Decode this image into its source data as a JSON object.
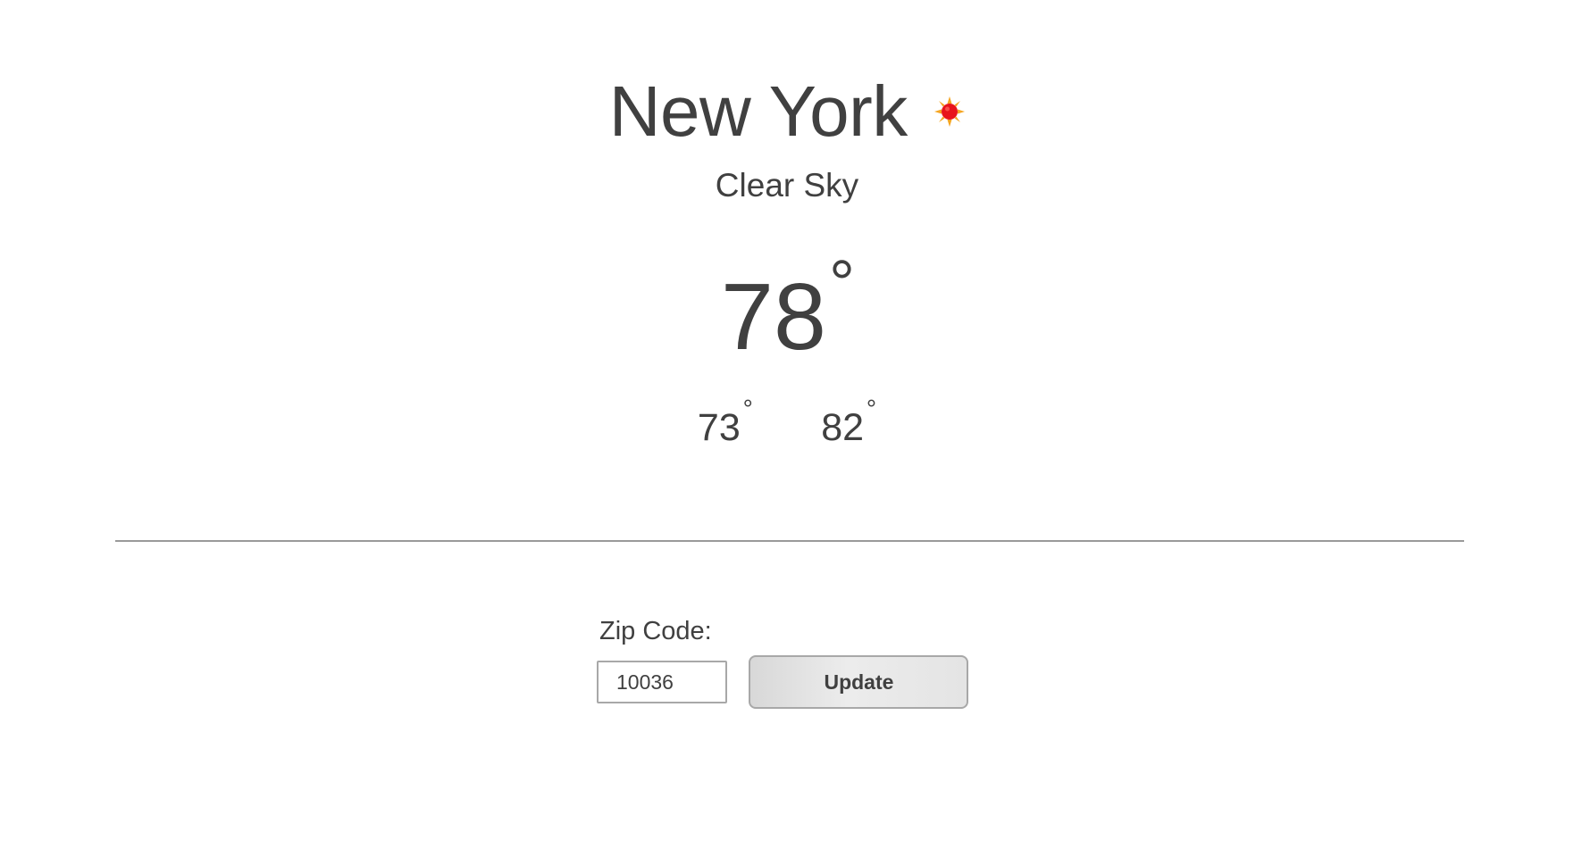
{
  "weather": {
    "city": "New York",
    "icon": "sun-icon",
    "condition": "Clear Sky",
    "current_temp": "78",
    "low_temp": "73",
    "high_temp": "82",
    "degree_symbol": "°"
  },
  "form": {
    "zip_label": "Zip Code:",
    "zip_value": "10036",
    "update_label": "Update"
  },
  "colors": {
    "text": "#404040",
    "sun_core": "#e8141b",
    "sun_rays": "#f5a623",
    "divider": "#9a9a9a"
  }
}
